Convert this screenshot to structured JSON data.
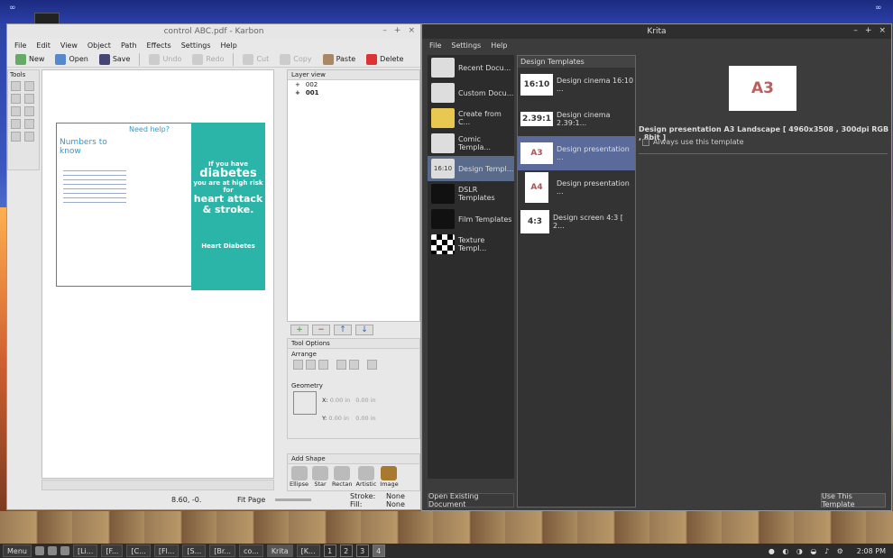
{
  "karbon": {
    "title": "control ABC.pdf - Karbon",
    "menu": [
      "File",
      "Edit",
      "View",
      "Object",
      "Path",
      "Effects",
      "Settings",
      "Help"
    ],
    "toolbar": {
      "new": "New",
      "open": "Open",
      "save": "Save",
      "undo": "Undo",
      "redo": "Redo",
      "cut": "Cut",
      "copy": "Copy",
      "paste": "Paste",
      "delete": "Delete"
    },
    "tools_label": "Tools",
    "layer_view_label": "Layer view",
    "layers": [
      "002",
      "001"
    ],
    "tool_options_label": "Tool Options",
    "arrange_label": "Arrange",
    "geometry_label": "Geometry",
    "geometry": {
      "x_label": "X:",
      "y_label": "Y:",
      "x_val": "0.00 in",
      "y_val": "0.00 in",
      "w_val": "0.00 in",
      "h_val": "0.00 in"
    },
    "add_shape_label": "Add Shape",
    "shapes": [
      "Ellipse",
      "Star",
      "Rectan",
      "Artistic",
      "Image"
    ],
    "status": {
      "coords": "8.60, -0.",
      "fit_page": "Fit Page",
      "stroke_label": "Stroke:",
      "stroke_val": "None",
      "fill_label": "Fill:",
      "fill_val": "None"
    },
    "doc": {
      "numbers_title": "Numbers to know",
      "need_help": "Need help?",
      "diabetes": "diabetes",
      "if_you_have": "If you have",
      "high_risk": "you are at high risk for",
      "heart_attack": "heart attack & stroke.",
      "heart_logo": "Heart Diabetes"
    }
  },
  "krita": {
    "title": "Krita",
    "menu": [
      "File",
      "Settings",
      "Help"
    ],
    "left_items": [
      "Recent Docu...",
      "Custom Docu...",
      "Create from C...",
      "Comic Templa...",
      "Design Templ...",
      "DSLR Templates",
      "Film Templates",
      "Texture Templ..."
    ],
    "templates_header": "Design Templates",
    "templates": [
      {
        "thumb": "16:10",
        "label": "Design cinema 16:10 ..."
      },
      {
        "thumb": "2.39:1",
        "label": "Design cinema 2.39:1..."
      },
      {
        "thumb": "A3",
        "label": "Design presentation ..."
      },
      {
        "thumb": "A4",
        "label": "Design presentation ..."
      },
      {
        "thumb": "4:3",
        "label": "Design screen 4:3 [ 2..."
      }
    ],
    "preview_thumb": "A3",
    "description": "Design presentation A3 Landscape [ 4960x3508 , 300dpi RGB , 8bit ]",
    "always_use": "Always use this template",
    "open_existing": "Open Existing Document",
    "use_template": "Use This Template",
    "left_thumb_1610": "16:10"
  },
  "taskbar": {
    "menu": "Menu",
    "tasks": [
      "[Li...",
      "[F...",
      "[C...",
      "[Fl...",
      "[S...",
      "[Br...",
      "co...",
      "Krita",
      "[K..."
    ],
    "workspaces": [
      "1",
      "2",
      "3",
      "4"
    ],
    "clock": "2:08 PM"
  }
}
